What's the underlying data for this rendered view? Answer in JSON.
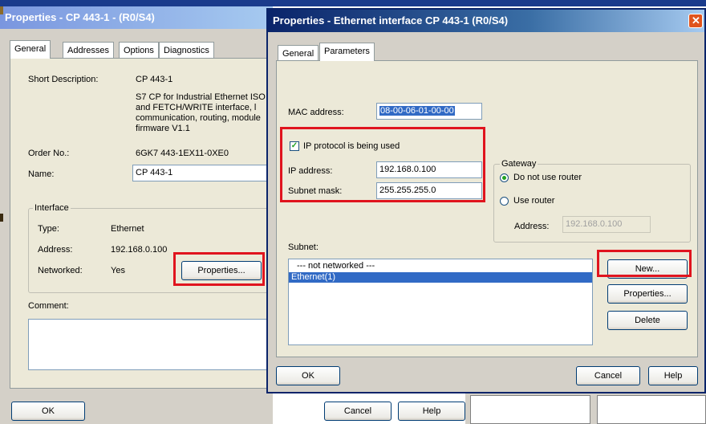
{
  "back_window": {
    "title": "Properties - CP 443-1 - (R0/S4)",
    "tabs": [
      "General",
      "Addresses",
      "Options",
      "Diagnostics"
    ],
    "short_description_label": "Short Description:",
    "short_description_value": "CP 443-1",
    "description_lines": [
      "S7 CP for Industrial Ethernet ISO",
      "and FETCH/WRITE interface, l",
      "communication, routing, module",
      "firmware V1.1"
    ],
    "order_no_label": "Order No.:",
    "order_no_value": "6GK7 443-1EX11-0XE0",
    "name_label": "Name:",
    "name_value": "CP 443-1",
    "interface_group": "Interface",
    "type_label": "Type:",
    "type_value": "Ethernet",
    "address_label": "Address:",
    "address_value": "192.168.0.100",
    "networked_label": "Networked:",
    "networked_value": "Yes",
    "properties_button": "Properties...",
    "comment_label": "Comment:",
    "ok_button": "OK",
    "cancel_button": "Cancel",
    "help_button": "Help"
  },
  "dialog": {
    "title": "Properties - Ethernet interface  CP 443-1 (R0/S4)",
    "close_icon": "close-icon",
    "tabs": [
      "General",
      "Parameters"
    ],
    "mac_label": "MAC address:",
    "mac_value": "08-00-06-01-00-00",
    "ip_protocol_label": "IP protocol is being used",
    "ip_protocol_checked": true,
    "ip_address_label": "IP address:",
    "ip_address_value": "192.168.0.100",
    "subnet_mask_label": "Subnet mask:",
    "subnet_mask_value": "255.255.255.0",
    "gateway_group": "Gateway",
    "gateway_options": [
      "Do not use router",
      "Use router"
    ],
    "gateway_selected": "Do not use router",
    "gateway_address_label": "Address:",
    "gateway_address_value": "192.168.0.100",
    "subnet_label": "Subnet:",
    "subnet_list": [
      "--- not networked ---",
      "Ethernet(1)"
    ],
    "subnet_selected": "Ethernet(1)",
    "new_button": "New...",
    "properties_button": "Properties...",
    "delete_button": "Delete",
    "ok_button": "OK",
    "cancel_button": "Cancel",
    "help_button": "Help"
  },
  "colors": {
    "highlight": "#e0141e",
    "selection": "#316ac5",
    "active_title": "#0a246a"
  }
}
